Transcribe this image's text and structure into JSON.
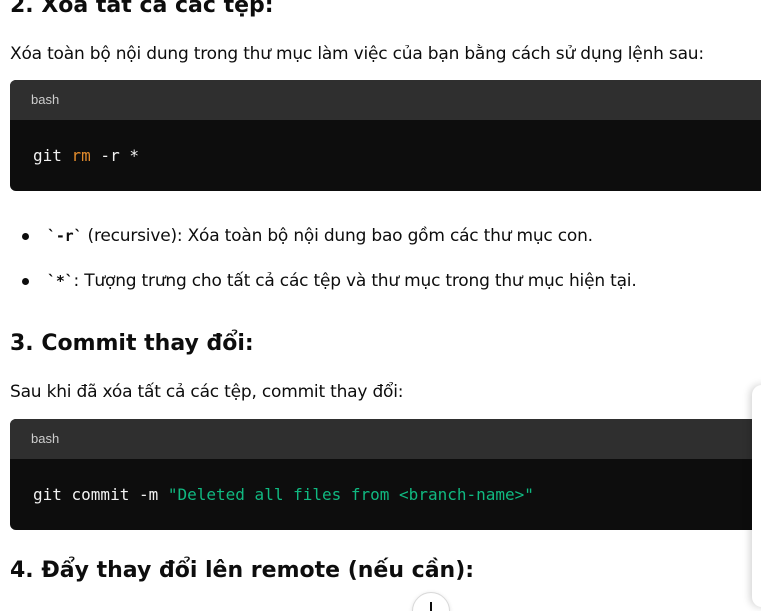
{
  "sections": {
    "section2": {
      "heading": "2. Xóa tất cả các tệp:",
      "intro": "Xóa toàn bộ nội dung trong thư mục làm việc của bạn bằng cách sử dụng lệnh sau:",
      "code": {
        "language": "bash",
        "tokens": {
          "cmd": "git ",
          "keyword": "rm",
          "args": " -r *"
        }
      },
      "bullets": [
        {
          "code": "`-r`",
          "text": " (recursive): Xóa toàn bộ nội dung bao gồm các thư mục con."
        },
        {
          "code": "`*`",
          "text": ": Tượng trưng cho tất cả các tệp và thư mục trong thư mục hiện tại."
        }
      ]
    },
    "section3": {
      "heading": "3. Commit thay đổi:",
      "intro": "Sau khi đã xóa tất cả các tệp, commit thay đổi:",
      "code": {
        "language": "bash",
        "tokens": {
          "cmd": "git commit -m ",
          "string": "\"Deleted all files from <branch-name>\""
        }
      }
    },
    "section4": {
      "heading": "4. Đẩy thay đổi lên remote (nếu cần):"
    }
  },
  "icons": {
    "scroll_down": "arrow-down-icon"
  },
  "colors": {
    "code_background": "#0d0d0d",
    "code_header": "#2f2f2f",
    "keyword": "#e08a2c",
    "string": "#10b981"
  }
}
